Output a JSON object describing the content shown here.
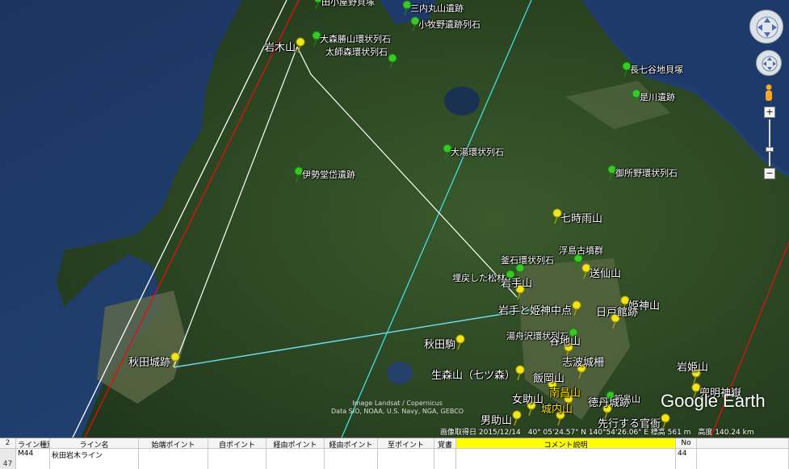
{
  "map": {
    "markers": [
      {
        "name": "marker-ishida",
        "label": "田小屋野貝塚",
        "color": "green",
        "hl": false
      },
      {
        "name": "marker-sannai",
        "label": "三内丸山遺跡",
        "color": "green",
        "hl": false
      },
      {
        "name": "marker-komakino",
        "label": "小牧野遺跡列石",
        "color": "green",
        "hl": false
      },
      {
        "name": "marker-iwakisan",
        "label": "岩木山",
        "color": "yellow",
        "hl": false
      },
      {
        "name": "marker-omori",
        "label": "大森勝山環状列石",
        "color": "green",
        "hl": false
      },
      {
        "name": "marker-taishido",
        "label": "太師森環状列石",
        "color": "green",
        "hl": false
      },
      {
        "name": "marker-nagashichiya",
        "label": "長七谷地貝塚",
        "color": "green",
        "hl": false
      },
      {
        "name": "marker-korekawa",
        "label": "是川遺跡",
        "color": "green",
        "hl": false
      },
      {
        "name": "marker-oyu",
        "label": "大湯環状列石",
        "color": "green",
        "hl": false
      },
      {
        "name": "marker-isedo",
        "label": "伊勢堂岱遺跡",
        "color": "green",
        "hl": false
      },
      {
        "name": "marker-goshono",
        "label": "御所野環状列石",
        "color": "green",
        "hl": false
      },
      {
        "name": "marker-nanashigure",
        "label": "七時雨山",
        "color": "yellow",
        "hl": false
      },
      {
        "name": "marker-ukishima",
        "label": "浮島古墳群",
        "color": "green",
        "hl": false
      },
      {
        "name": "marker-kaneishi",
        "label": "釜石環状列石",
        "color": "green",
        "hl": false
      },
      {
        "name": "marker-okuyama",
        "label": "送仙山",
        "color": "yellow",
        "hl": false
      },
      {
        "name": "marker-matsubayashi",
        "label": "埋戻した松林",
        "color": "green",
        "hl": false
      },
      {
        "name": "marker-iwatesan",
        "label": "岩手山",
        "color": "yellow",
        "hl": false
      },
      {
        "name": "marker-himekami",
        "label": "姫神山",
        "color": "yellow",
        "hl": false
      },
      {
        "name": "marker-iwate-center",
        "label": "岩手と姫神中点",
        "color": "yellow",
        "hl": false
      },
      {
        "name": "marker-hinoto",
        "label": "日戸館跡",
        "color": "yellow",
        "hl": false
      },
      {
        "name": "marker-yubune",
        "label": "湯舟沢環状列石",
        "color": "green",
        "hl": false
      },
      {
        "name": "marker-akitakoma",
        "label": "秋田駒",
        "color": "yellow",
        "hl": false
      },
      {
        "name": "marker-tanichi",
        "label": "谷地山",
        "color": "yellow",
        "hl": false
      },
      {
        "name": "marker-akitajo",
        "label": "秋田城跡",
        "color": "yellow",
        "hl": false
      },
      {
        "name": "marker-shiwa",
        "label": "志波城柵",
        "color": "yellow",
        "hl": false
      },
      {
        "name": "marker-namamori",
        "label": "生森山（七ツ森）",
        "color": "yellow",
        "hl": false
      },
      {
        "name": "marker-iioka",
        "label": "飯岡山",
        "color": "yellow",
        "hl": false
      },
      {
        "name": "marker-asashima",
        "label": "朝島山",
        "color": "green",
        "hl": false
      },
      {
        "name": "marker-iwahime",
        "label": "岩姫山",
        "color": "yellow",
        "hl": false
      },
      {
        "name": "marker-jigoku",
        "label": "兜明神嶽",
        "color": "yellow",
        "hl": false
      },
      {
        "name": "marker-nanshozan",
        "label": "南昌山",
        "color": "yellow",
        "hl": true
      },
      {
        "name": "marker-tokutan",
        "label": "徳丹城跡",
        "color": "yellow",
        "hl": false
      },
      {
        "name": "marker-onnasuke",
        "label": "女助山",
        "color": "yellow",
        "hl": false
      },
      {
        "name": "marker-otokosuke",
        "label": "男助山",
        "color": "yellow",
        "hl": false
      },
      {
        "name": "marker-jonai",
        "label": "城内山",
        "color": "yellow",
        "hl": true
      },
      {
        "name": "marker-sakiyuku",
        "label": "先行する官衙",
        "color": "yellow",
        "hl": false
      }
    ],
    "logo": "Google Earth",
    "attribution_line1": "Image Landsat / Copernicus",
    "attribution_line2": "Data SIO, NOAA, U.S. Navy, NGA, GEBCO",
    "status_bar": "画像取得日 2015/12/14　40° 05'24.57\" N 140°54'26.06\" E 標高 561 m　高度 140.24 km"
  },
  "sheet": {
    "header_row_num": "2",
    "data_row_num": "47",
    "headers": [
      "ライン種別",
      "ライン名",
      "始端ポイント",
      "自ポイント",
      "経由ポイント",
      "経由ポイント",
      "至ポイント",
      "覚書",
      "コメント説明",
      "No"
    ],
    "row": [
      "M44",
      "秋田岩木ライン",
      "",
      "",
      "",
      "",
      "",
      "",
      "",
      "44"
    ],
    "comment_header_color": "#ffff00"
  }
}
